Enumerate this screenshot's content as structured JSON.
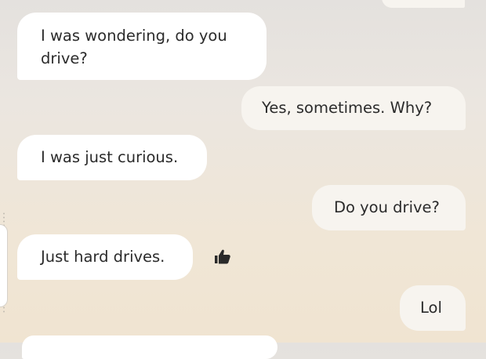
{
  "chat": {
    "messages": [
      {
        "sender": "bot",
        "text": "I was wondering, do you drive?"
      },
      {
        "sender": "user",
        "text": "Yes, sometimes. Why?"
      },
      {
        "sender": "bot",
        "text": "I was just curious."
      },
      {
        "sender": "user",
        "text": "Do you drive?"
      },
      {
        "sender": "bot",
        "text": "Just hard drives."
      },
      {
        "sender": "user",
        "text": "Lol"
      }
    ],
    "reaction_icon": "thumbs-up-icon",
    "colors": {
      "bot_bubble": "#ffffff",
      "user_bubble": "#f7f4ef",
      "text": "#2b2b2b",
      "background_top": "#e4e1de",
      "background_bottom": "#f0e4d1"
    }
  }
}
